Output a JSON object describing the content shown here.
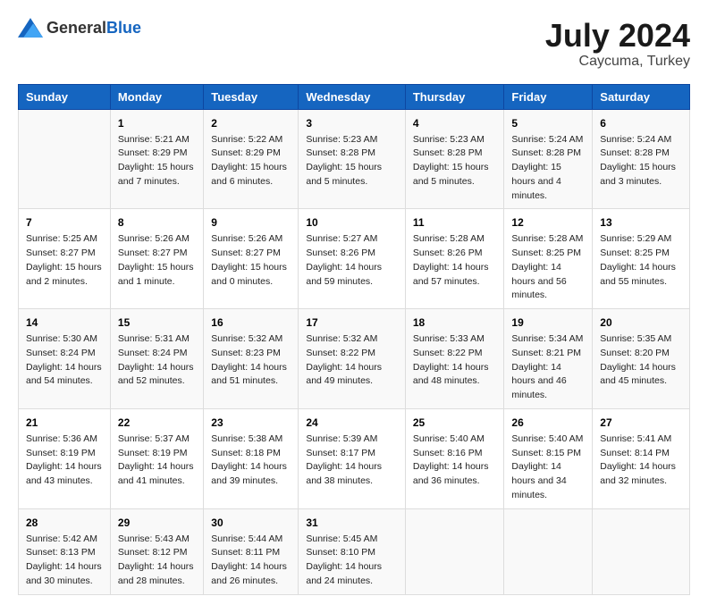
{
  "header": {
    "logo": {
      "text_general": "General",
      "text_blue": "Blue"
    },
    "title": "July 2024",
    "location": "Caycuma, Turkey"
  },
  "days_of_week": [
    "Sunday",
    "Monday",
    "Tuesday",
    "Wednesday",
    "Thursday",
    "Friday",
    "Saturday"
  ],
  "weeks": [
    [
      {
        "day": "",
        "sunrise": "",
        "sunset": "",
        "daylight": ""
      },
      {
        "day": "1",
        "sunrise": "Sunrise: 5:21 AM",
        "sunset": "Sunset: 8:29 PM",
        "daylight": "Daylight: 15 hours and 7 minutes."
      },
      {
        "day": "2",
        "sunrise": "Sunrise: 5:22 AM",
        "sunset": "Sunset: 8:29 PM",
        "daylight": "Daylight: 15 hours and 6 minutes."
      },
      {
        "day": "3",
        "sunrise": "Sunrise: 5:23 AM",
        "sunset": "Sunset: 8:28 PM",
        "daylight": "Daylight: 15 hours and 5 minutes."
      },
      {
        "day": "4",
        "sunrise": "Sunrise: 5:23 AM",
        "sunset": "Sunset: 8:28 PM",
        "daylight": "Daylight: 15 hours and 5 minutes."
      },
      {
        "day": "5",
        "sunrise": "Sunrise: 5:24 AM",
        "sunset": "Sunset: 8:28 PM",
        "daylight": "Daylight: 15 hours and 4 minutes."
      },
      {
        "day": "6",
        "sunrise": "Sunrise: 5:24 AM",
        "sunset": "Sunset: 8:28 PM",
        "daylight": "Daylight: 15 hours and 3 minutes."
      }
    ],
    [
      {
        "day": "7",
        "sunrise": "Sunrise: 5:25 AM",
        "sunset": "Sunset: 8:27 PM",
        "daylight": "Daylight: 15 hours and 2 minutes."
      },
      {
        "day": "8",
        "sunrise": "Sunrise: 5:26 AM",
        "sunset": "Sunset: 8:27 PM",
        "daylight": "Daylight: 15 hours and 1 minute."
      },
      {
        "day": "9",
        "sunrise": "Sunrise: 5:26 AM",
        "sunset": "Sunset: 8:27 PM",
        "daylight": "Daylight: 15 hours and 0 minutes."
      },
      {
        "day": "10",
        "sunrise": "Sunrise: 5:27 AM",
        "sunset": "Sunset: 8:26 PM",
        "daylight": "Daylight: 14 hours and 59 minutes."
      },
      {
        "day": "11",
        "sunrise": "Sunrise: 5:28 AM",
        "sunset": "Sunset: 8:26 PM",
        "daylight": "Daylight: 14 hours and 57 minutes."
      },
      {
        "day": "12",
        "sunrise": "Sunrise: 5:28 AM",
        "sunset": "Sunset: 8:25 PM",
        "daylight": "Daylight: 14 hours and 56 minutes."
      },
      {
        "day": "13",
        "sunrise": "Sunrise: 5:29 AM",
        "sunset": "Sunset: 8:25 PM",
        "daylight": "Daylight: 14 hours and 55 minutes."
      }
    ],
    [
      {
        "day": "14",
        "sunrise": "Sunrise: 5:30 AM",
        "sunset": "Sunset: 8:24 PM",
        "daylight": "Daylight: 14 hours and 54 minutes."
      },
      {
        "day": "15",
        "sunrise": "Sunrise: 5:31 AM",
        "sunset": "Sunset: 8:24 PM",
        "daylight": "Daylight: 14 hours and 52 minutes."
      },
      {
        "day": "16",
        "sunrise": "Sunrise: 5:32 AM",
        "sunset": "Sunset: 8:23 PM",
        "daylight": "Daylight: 14 hours and 51 minutes."
      },
      {
        "day": "17",
        "sunrise": "Sunrise: 5:32 AM",
        "sunset": "Sunset: 8:22 PM",
        "daylight": "Daylight: 14 hours and 49 minutes."
      },
      {
        "day": "18",
        "sunrise": "Sunrise: 5:33 AM",
        "sunset": "Sunset: 8:22 PM",
        "daylight": "Daylight: 14 hours and 48 minutes."
      },
      {
        "day": "19",
        "sunrise": "Sunrise: 5:34 AM",
        "sunset": "Sunset: 8:21 PM",
        "daylight": "Daylight: 14 hours and 46 minutes."
      },
      {
        "day": "20",
        "sunrise": "Sunrise: 5:35 AM",
        "sunset": "Sunset: 8:20 PM",
        "daylight": "Daylight: 14 hours and 45 minutes."
      }
    ],
    [
      {
        "day": "21",
        "sunrise": "Sunrise: 5:36 AM",
        "sunset": "Sunset: 8:19 PM",
        "daylight": "Daylight: 14 hours and 43 minutes."
      },
      {
        "day": "22",
        "sunrise": "Sunrise: 5:37 AM",
        "sunset": "Sunset: 8:19 PM",
        "daylight": "Daylight: 14 hours and 41 minutes."
      },
      {
        "day": "23",
        "sunrise": "Sunrise: 5:38 AM",
        "sunset": "Sunset: 8:18 PM",
        "daylight": "Daylight: 14 hours and 39 minutes."
      },
      {
        "day": "24",
        "sunrise": "Sunrise: 5:39 AM",
        "sunset": "Sunset: 8:17 PM",
        "daylight": "Daylight: 14 hours and 38 minutes."
      },
      {
        "day": "25",
        "sunrise": "Sunrise: 5:40 AM",
        "sunset": "Sunset: 8:16 PM",
        "daylight": "Daylight: 14 hours and 36 minutes."
      },
      {
        "day": "26",
        "sunrise": "Sunrise: 5:40 AM",
        "sunset": "Sunset: 8:15 PM",
        "daylight": "Daylight: 14 hours and 34 minutes."
      },
      {
        "day": "27",
        "sunrise": "Sunrise: 5:41 AM",
        "sunset": "Sunset: 8:14 PM",
        "daylight": "Daylight: 14 hours and 32 minutes."
      }
    ],
    [
      {
        "day": "28",
        "sunrise": "Sunrise: 5:42 AM",
        "sunset": "Sunset: 8:13 PM",
        "daylight": "Daylight: 14 hours and 30 minutes."
      },
      {
        "day": "29",
        "sunrise": "Sunrise: 5:43 AM",
        "sunset": "Sunset: 8:12 PM",
        "daylight": "Daylight: 14 hours and 28 minutes."
      },
      {
        "day": "30",
        "sunrise": "Sunrise: 5:44 AM",
        "sunset": "Sunset: 8:11 PM",
        "daylight": "Daylight: 14 hours and 26 minutes."
      },
      {
        "day": "31",
        "sunrise": "Sunrise: 5:45 AM",
        "sunset": "Sunset: 8:10 PM",
        "daylight": "Daylight: 14 hours and 24 minutes."
      },
      {
        "day": "",
        "sunrise": "",
        "sunset": "",
        "daylight": ""
      },
      {
        "day": "",
        "sunrise": "",
        "sunset": "",
        "daylight": ""
      },
      {
        "day": "",
        "sunrise": "",
        "sunset": "",
        "daylight": ""
      }
    ]
  ]
}
